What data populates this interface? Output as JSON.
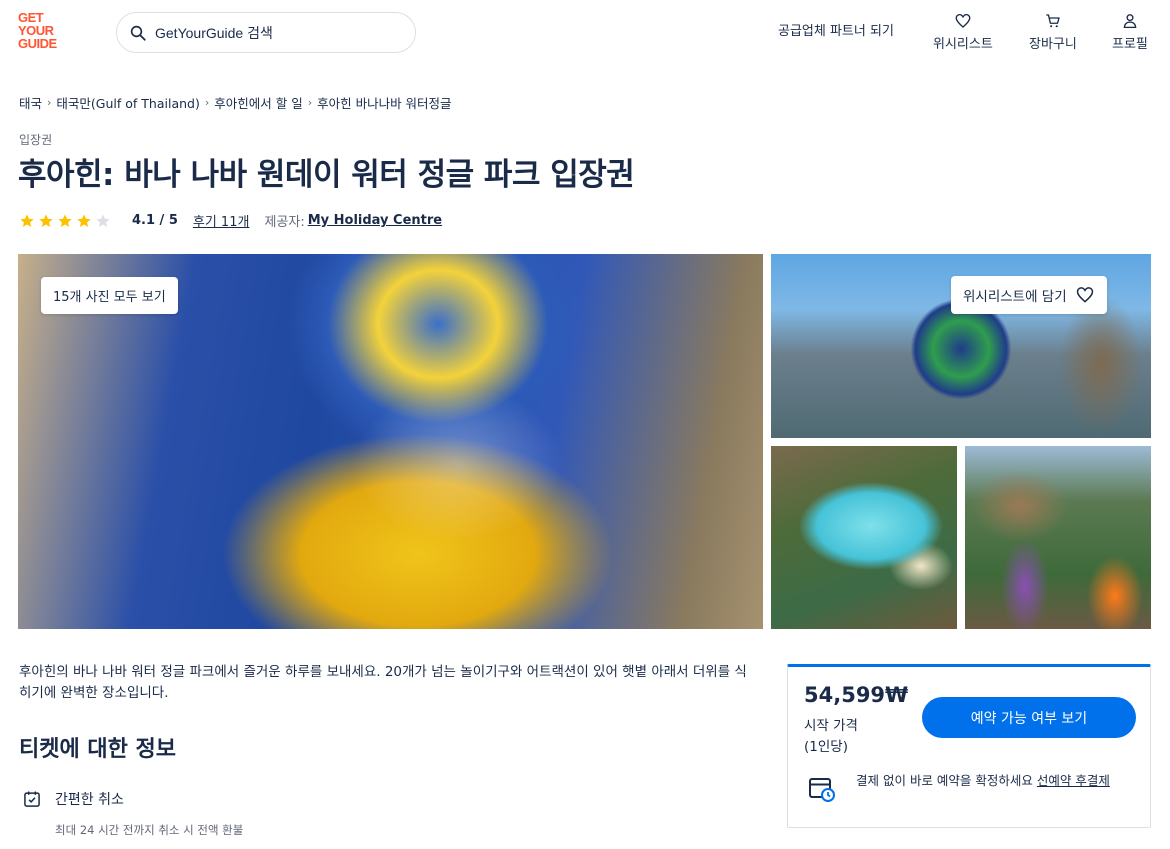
{
  "header": {
    "logo_lines": [
      "GET",
      "YOUR",
      "GUIDE"
    ],
    "search_placeholder": "GetYourGuide 검색",
    "supplier_link": "공급업체 파트너 되기",
    "nav": {
      "wishlist": "위시리스트",
      "cart": "장바구니",
      "profile": "프로필"
    }
  },
  "breadcrumb": [
    "태국",
    "태국만(Gulf of Thailand)",
    "후아힌에서 할 일",
    "후아힌 바나나바 워터정글"
  ],
  "product": {
    "category": "입장권",
    "title": "후아힌: 바나 나바 원데이 워터 정글 파크 입장권",
    "rating": 4.1,
    "rating_text": "4.1 / 5",
    "reviews_link": "후기 11개",
    "provider_label": "제공자:",
    "provider_name": "My Holiday Centre"
  },
  "gallery": {
    "all_photos_button": "15개 사진 모두 보기",
    "wishlist_button": "위시리스트에 담기"
  },
  "description": "후아힌의 바나 나바 워터 정글 파크에서 즐거운 하루를 보내세요. 20개가 넘는 놀이기구와 어트랙션이 있어 햇볕 아래서 더위를 식히기에 완벽한 장소입니다.",
  "ticket_info": {
    "title": "티켓에 대한 정보",
    "features": [
      {
        "label": "간편한 취소",
        "sub": "최대 24 시간 전까지 취소 시 전액 환불"
      }
    ]
  },
  "booking": {
    "price": "54,599₩",
    "price_label": "시작 가격",
    "price_per": "(1인당)",
    "check_button": "예약 가능 여부 보기",
    "note": "결제 없이 바로 예약을 확정하세요",
    "note_link": "선예약 후결제"
  },
  "colors": {
    "brand": "#ff5533",
    "primary": "#0071eb",
    "text": "#1a2b49",
    "star": "#fdc100"
  }
}
